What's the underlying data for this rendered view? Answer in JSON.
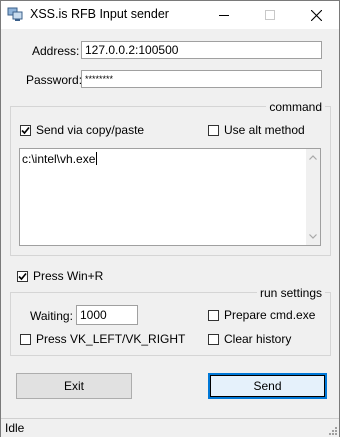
{
  "window": {
    "title": "XSS.is RFB Input sender",
    "icon": "network-computer-icon"
  },
  "connection": {
    "address_label": "Address:",
    "address_value": "127.0.0.2:100500",
    "password_label": "Password:",
    "password_value": "********"
  },
  "command": {
    "group_title": "command",
    "send_via_copy_label": "Send via copy/paste",
    "send_via_copy_checked": true,
    "use_alt_label": "Use alt method",
    "use_alt_checked": false,
    "text": "c:\\intel\\vh.exe"
  },
  "press_win_r": {
    "label": "Press Win+R",
    "checked": true
  },
  "run_settings": {
    "group_title": "run settings",
    "waiting_label": "Waiting:",
    "waiting_value": "1000",
    "prepare_cmd_label": "Prepare cmd.exe",
    "prepare_cmd_checked": false,
    "press_vk_label": "Press VK_LEFT/VK_RIGHT",
    "press_vk_checked": false,
    "clear_history_label": "Clear history",
    "clear_history_checked": false
  },
  "buttons": {
    "exit_label": "Exit",
    "send_label": "Send"
  },
  "status": {
    "text": "Idle"
  },
  "colors": {
    "focus_accent": "#0078d7",
    "window_bg": "#f0f0f0"
  }
}
